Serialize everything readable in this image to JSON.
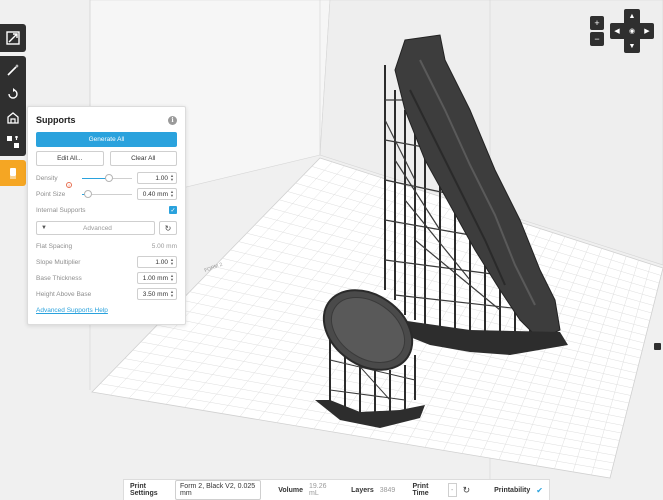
{
  "panel": {
    "title": "Supports",
    "generate_all": "Generate All",
    "edit_all": "Edit All...",
    "clear_all": "Clear All",
    "density_label": "Density",
    "density_value": "1.00",
    "density_fraction": 0.55,
    "point_size_label": "Point Size",
    "point_size_value": "0.40 mm",
    "point_size_fraction": 0.05,
    "internal_supports_label": "Internal Supports",
    "internal_supports_checked": true,
    "advanced_label": "Advanced",
    "flat_spacing_label": "Flat Spacing",
    "flat_spacing_value": "5.00 mm",
    "slope_multiplier_label": "Slope Multiplier",
    "slope_multiplier_value": "1.00",
    "base_thickness_label": "Base Thickness",
    "base_thickness_value": "1.00 mm",
    "height_above_base_label": "Height Above Base",
    "height_above_base_value": "3.50 mm",
    "help_link": "Advanced Supports Help"
  },
  "toolbar": {
    "icons": [
      "expand-icon",
      "magic-wand-icon",
      "rotate-icon",
      "orient-icon",
      "layout-icon",
      "supports-icon"
    ],
    "active": "supports-icon"
  },
  "status_bar": {
    "print_settings_label": "Print Settings",
    "print_settings_value": "Form 2, Black V2, 0.025 mm",
    "volume_label": "Volume",
    "volume_value": "19.26 mL",
    "layers_label": "Layers",
    "layers_value": "3849",
    "print_time_label": "Print Time",
    "print_time_value": "-",
    "printability_label": "Printability"
  },
  "scene": {
    "build_plate_label": "FORM 2"
  },
  "colors": {
    "accent": "#2aa2dd",
    "active_tool": "#f5a623",
    "toolbar_bg": "#2f2f2f",
    "model": "#3a3a3a"
  }
}
